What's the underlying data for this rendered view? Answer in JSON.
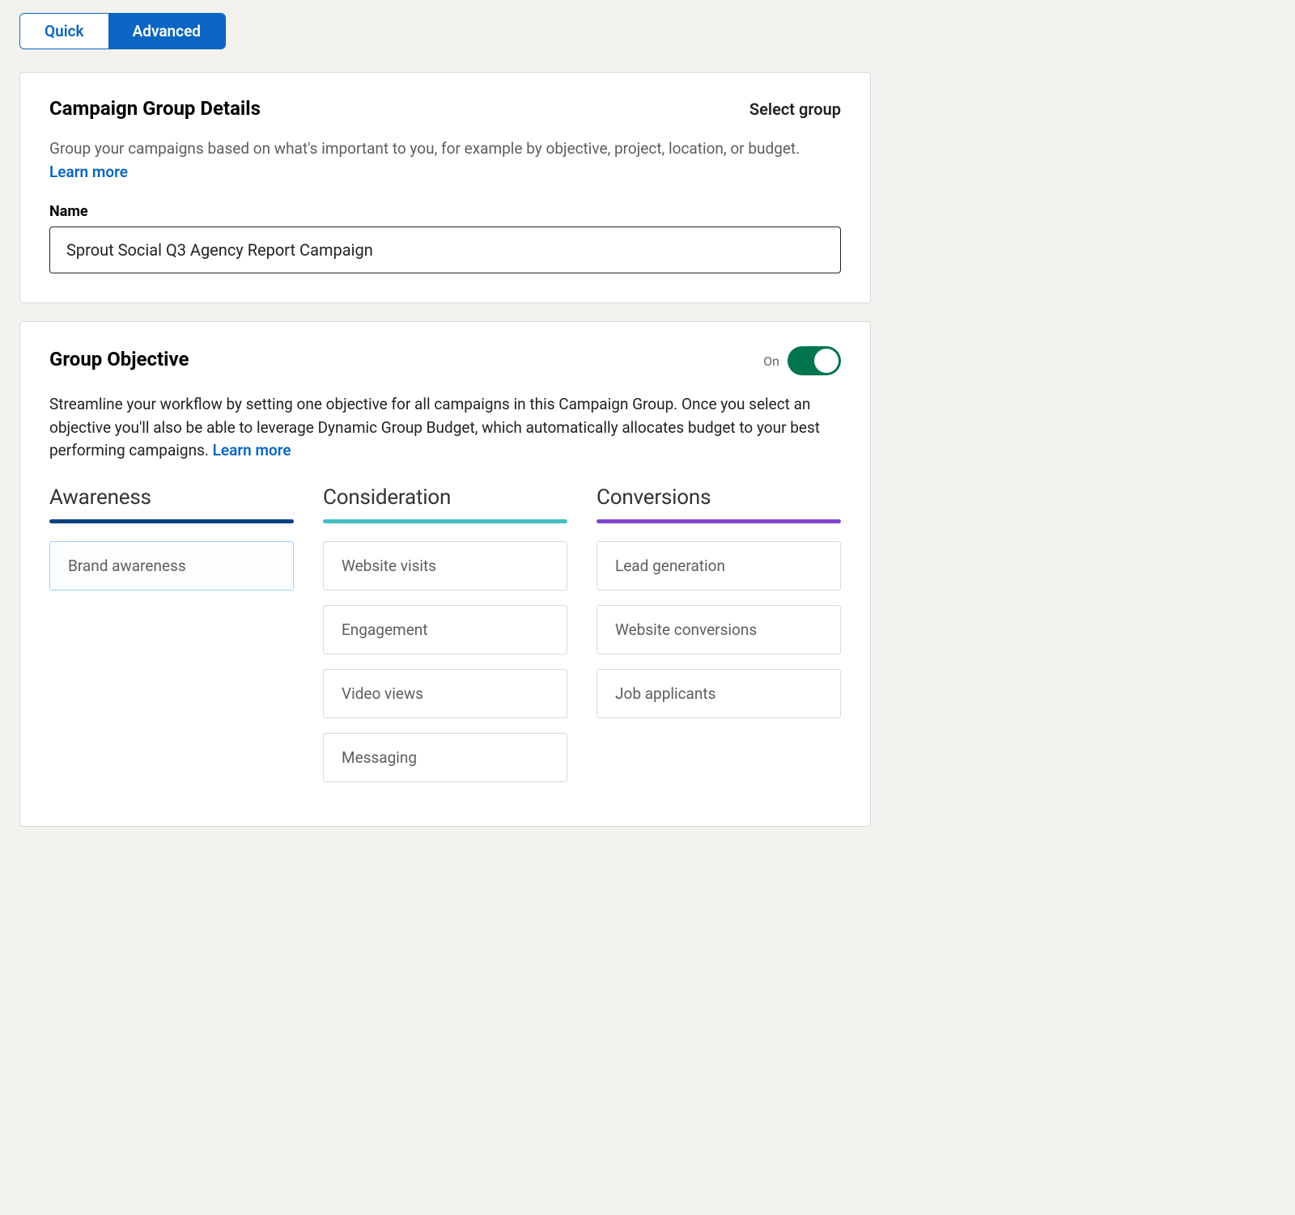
{
  "mode_tabs": {
    "quick": "Quick",
    "advanced": "Advanced"
  },
  "details": {
    "title": "Campaign Group Details",
    "select_group": "Select group",
    "description": "Group your campaigns based on what's important to you, for example by objective, project, location, or budget. ",
    "learn_more": "Learn more",
    "name_label": "Name",
    "name_value": "Sprout Social Q3 Agency Report Campaign"
  },
  "objective": {
    "title": "Group Objective",
    "toggle_label": "On",
    "toggle_on": true,
    "description": "Streamline your workflow by setting one objective for all campaigns in this Campaign Group. Once you select an objective you'll also be able to leverage Dynamic Group Budget, which automatically allocates budget to your best performing campaigns. ",
    "learn_more": "Learn more",
    "columns": {
      "awareness": {
        "heading": "Awareness",
        "items": [
          "Brand awareness"
        ]
      },
      "consideration": {
        "heading": "Consideration",
        "items": [
          "Website visits",
          "Engagement",
          "Video views",
          "Messaging"
        ]
      },
      "conversions": {
        "heading": "Conversions",
        "items": [
          "Lead generation",
          "Website conversions",
          "Job applicants"
        ]
      }
    },
    "selected": "Brand awareness"
  }
}
